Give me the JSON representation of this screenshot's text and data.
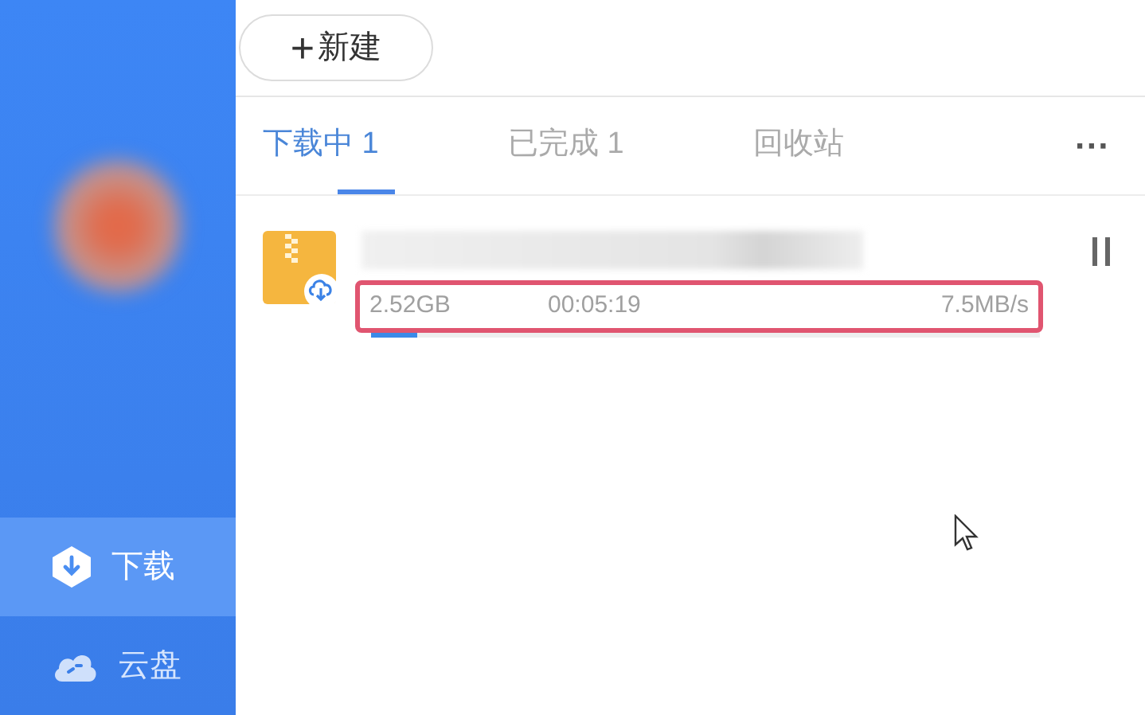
{
  "sidebar": {
    "items": [
      {
        "label": "下载",
        "kind": "download",
        "selected": true
      },
      {
        "label": "云盘",
        "kind": "cloud",
        "selected": false
      }
    ]
  },
  "new_button": {
    "label": "新建",
    "icon": "+"
  },
  "tabs": [
    {
      "label": "下载中",
      "count": "1",
      "selected": true
    },
    {
      "label": "已完成",
      "count": "1",
      "selected": false
    },
    {
      "label": "回收站",
      "selected": false
    }
  ],
  "more_icon": "···",
  "downloads": [
    {
      "size": "2.52GB",
      "remaining": "00:05:19",
      "speed": "7.5MB/s",
      "level": 0.07
    }
  ]
}
